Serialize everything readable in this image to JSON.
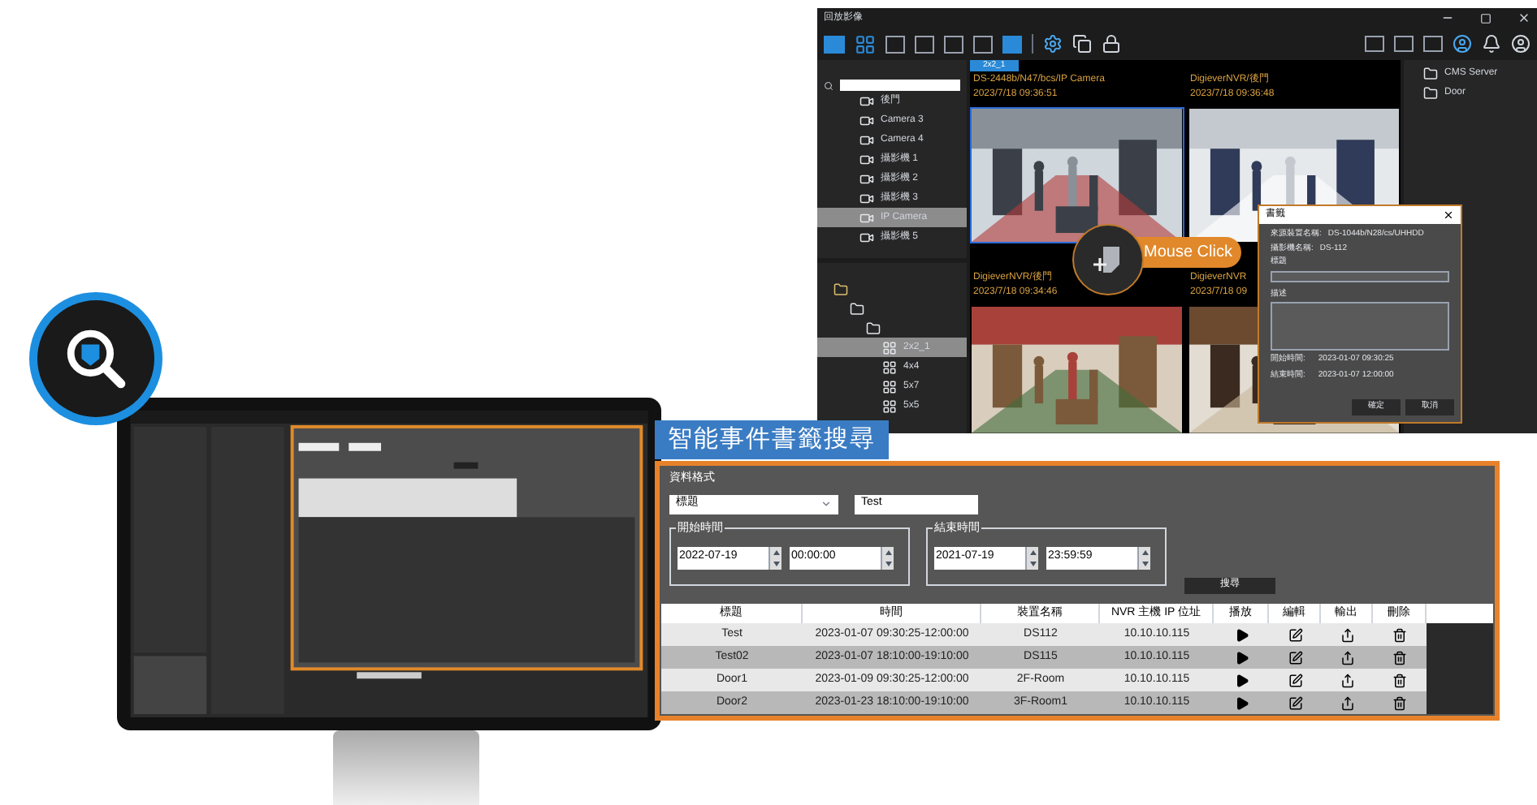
{
  "video_window": {
    "title": "回放影像",
    "tab": "2x2_1",
    "device_tree": [
      {
        "label": "後門"
      },
      {
        "label": "Camera 3"
      },
      {
        "label": "Camera 4"
      },
      {
        "label": "攝影機 1"
      },
      {
        "label": "攝影機 2"
      },
      {
        "label": "攝影機 3"
      },
      {
        "label": "IP Camera",
        "selected": true
      },
      {
        "label": "攝影機 5"
      }
    ],
    "layout_tree": [
      {
        "label": "2x2_1",
        "selected": true
      },
      {
        "label": "4x4",
        "selected": false
      },
      {
        "label": "5x7",
        "selected": false
      },
      {
        "label": "5x5",
        "selected": false
      }
    ],
    "access_tree": [
      {
        "label": "CMS Server"
      },
      {
        "label": "Door"
      }
    ],
    "feeds": [
      {
        "source": "DS-2448b/N47/bcs/IP Camera",
        "time": "2023/7/18 09:36:51",
        "active": true
      },
      {
        "source": "DigieverNVR/後門",
        "time": "2023/7/18 09:36:48",
        "active": false
      },
      {
        "source": "DigieverNVR/後門",
        "time": "2023/7/18 09:34:46",
        "active": false
      },
      {
        "source": "DigieverNVR",
        "time": "2023/7/18 09",
        "active": false
      }
    ]
  },
  "bookmark_dialog": {
    "title": "書籤",
    "fields": [
      {
        "label": "來源裝置名稱:",
        "value": "DS-1044b/N28/cs/UHHDD"
      },
      {
        "label": "攝影機名稱:",
        "value": "DS-112"
      }
    ],
    "title_label": "標題",
    "description_label": "描述",
    "times": [
      {
        "label": "開始時間:",
        "value": "2023-01-07 09:30:25"
      },
      {
        "label": "結束時間:",
        "value": "2023-01-07 12:00:00"
      }
    ],
    "buttons": [
      "確定",
      "取消"
    ]
  },
  "callout": "Mouse Click",
  "feature_title": "智能事件書籤搜尋",
  "search_panel": {
    "format_label": "資料格式",
    "field_select": "標題",
    "keyword": "Test",
    "start": {
      "label": "開始時間",
      "date": "2022-07-19",
      "time": "00:00:00"
    },
    "end": {
      "label": "結束時間",
      "date": "2021-07-19",
      "time": "23:59:59"
    },
    "search_button": "搜尋",
    "columns": [
      "標題",
      "時間",
      "裝置名稱",
      "NVR 主機 IP 位址",
      "播放",
      "編輯",
      "輸出",
      "刪除"
    ],
    "rows": [
      [
        "Test",
        "2023-01-07 09:30:25-12:00:00",
        "DS112",
        "10.10.10.115"
      ],
      [
        "Test02",
        "2023-01-07 18:10:00-19:10:00",
        "DS115",
        "10.10.10.115"
      ],
      [
        "Door1",
        "2023-01-09 09:30:25-12:00:00",
        "2F-Room",
        "10.10.10.115"
      ],
      [
        "Door2",
        "2023-01-23 18:10:00-19:10:00",
        "3F-Room1",
        "10.10.10.115"
      ]
    ]
  }
}
